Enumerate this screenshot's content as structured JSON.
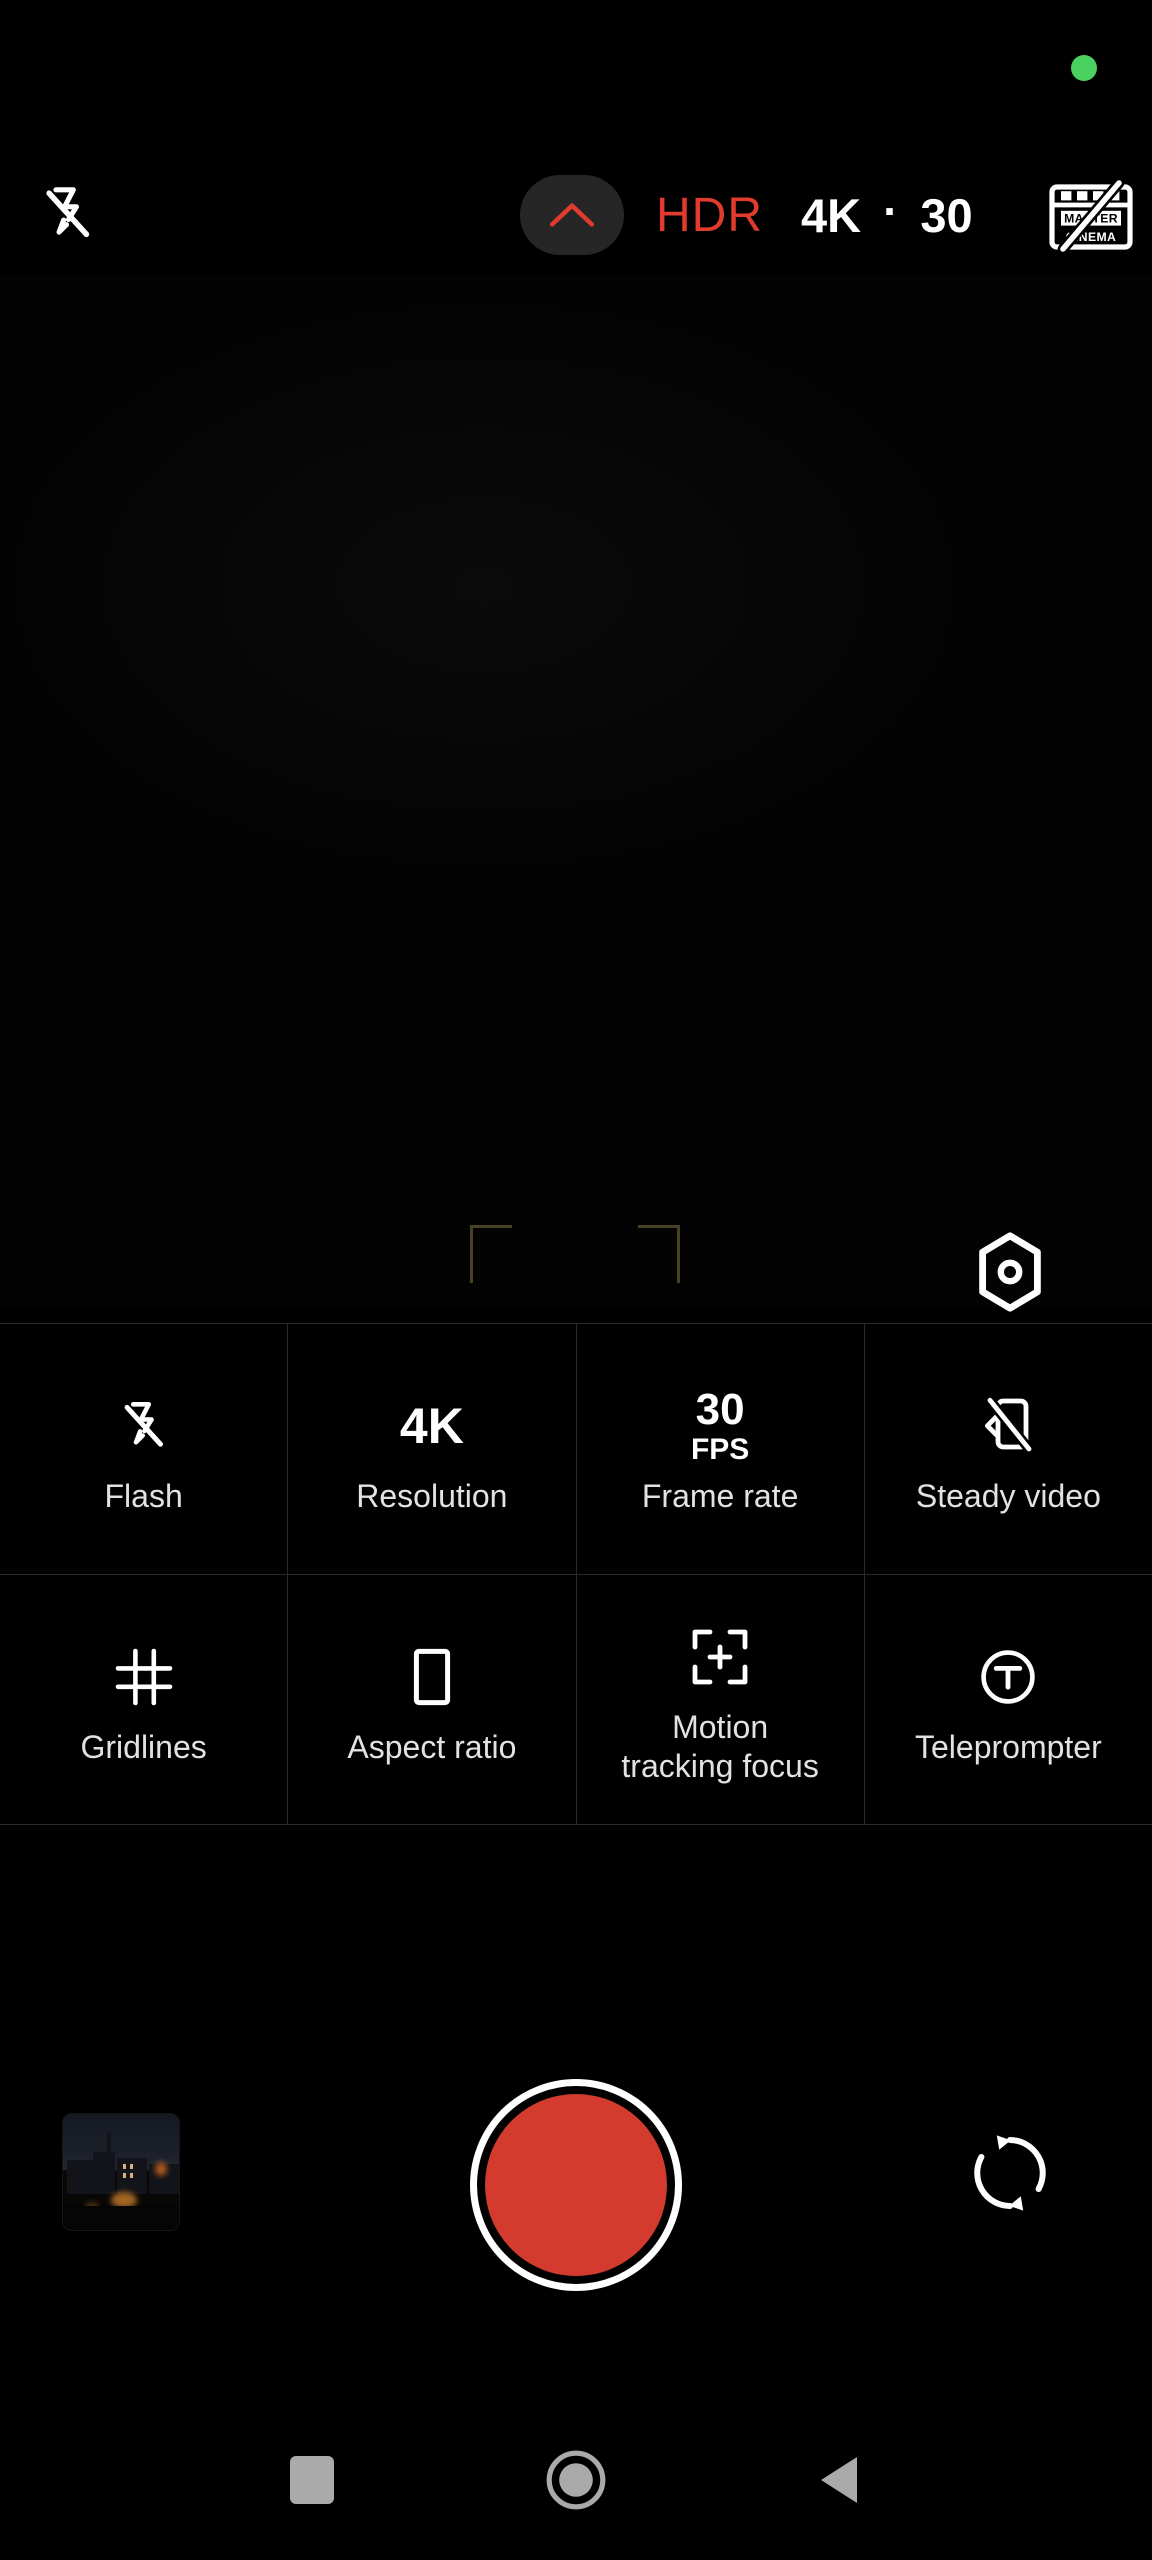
{
  "status": {
    "privacy_indicator": "green-privacy-dot",
    "privacy_color": "#4ad15f"
  },
  "top_bar": {
    "flash_icon": "flash-off-icon",
    "expand_icon": "chevron-up-icon",
    "expand_color": "#e03b2c",
    "hdr_label": "HDR",
    "hdr_color": "#e03b2c",
    "resolution_label": "4K",
    "separator": "·",
    "framerate_label": "30",
    "master_cinema_icon": "master-cinema-off-icon",
    "master_cinema_text_line1": "MASTER",
    "master_cinema_text_line2": "CINEMA"
  },
  "viewfinder": {
    "focus_bracket_color": "#4a4125",
    "pro_mode_icon": "aperture-hexagon-icon"
  },
  "settings_panel": {
    "rows": [
      {
        "tiles": [
          {
            "label": "Flash",
            "icon": "flash-off-icon",
            "value": ""
          },
          {
            "label": "Resolution",
            "icon": "text-icon",
            "value": "4K"
          },
          {
            "label": "Frame rate",
            "icon": "text-icon",
            "value": "30",
            "value_unit": "FPS"
          },
          {
            "label": "Steady video",
            "icon": "steady-video-off-icon",
            "value": ""
          }
        ]
      },
      {
        "tiles": [
          {
            "label": "Gridlines",
            "icon": "gridlines-icon",
            "value": ""
          },
          {
            "label": "Aspect ratio",
            "icon": "aspect-ratio-icon",
            "value": ""
          },
          {
            "label": "Motion\ntracking focus",
            "icon": "motion-tracking-icon",
            "value": "",
            "label_line1": "Motion",
            "label_line2": "tracking focus"
          },
          {
            "label": "Teleprompter",
            "icon": "teleprompter-icon",
            "value": "T"
          }
        ]
      }
    ]
  },
  "shutter_bar": {
    "gallery_thumbnail": "gallery-thumbnail-night-city",
    "record_button": "record-button",
    "record_color": "#d23b2e",
    "flip_camera_icon": "flip-camera-icon"
  },
  "nav_bar": {
    "recents_icon": "square-recents-icon",
    "home_icon": "circle-home-icon",
    "back_icon": "triangle-back-icon",
    "icon_color": "#aaaaaa"
  }
}
